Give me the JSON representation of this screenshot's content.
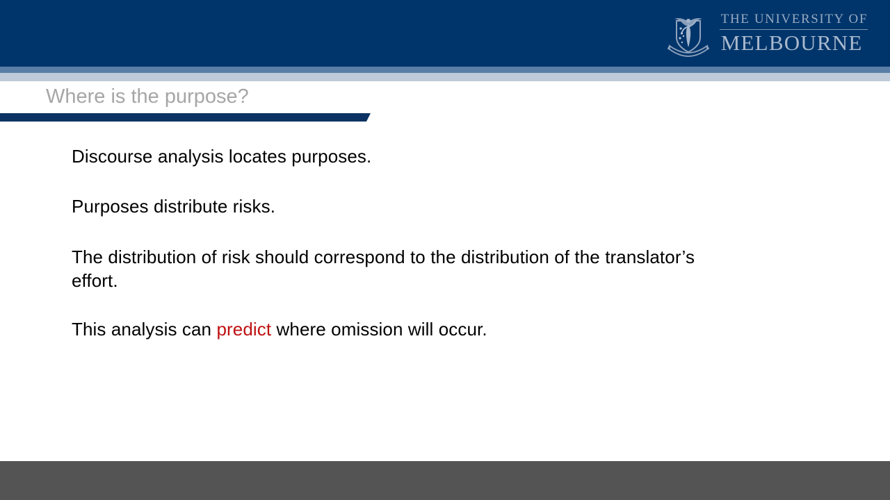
{
  "slide": {
    "title": "Where is the purpose?",
    "body_lines": [
      {
        "id": "line1",
        "text": "Discourse analysis locates purposes."
      },
      {
        "id": "line2",
        "text": "Purposes distribute risks."
      },
      {
        "id": "line3",
        "text": "The distribution of risk should correspond to the distribution of the translator’s effort."
      },
      {
        "id": "line4",
        "prefix": "This analysis can ",
        "highlight": "predict",
        "suffix": " where omission will occur."
      }
    ]
  },
  "branding": {
    "logo_line1": "THE UNIVERSITY OF",
    "logo_line2": "MELBOURNE",
    "crest_icon": "university-crest-icon"
  },
  "colors": {
    "header_navy": "#00356b",
    "stripe_slate": "#5a7fa6",
    "stripe_light": "#bfcbd8",
    "title_gray": "#a6a6a6",
    "title_underline_navy": "#0b3263",
    "highlight_red": "#bf1111",
    "footer_gray": "#545454",
    "body_text": "#000000",
    "logo_text": "#a9b9cd"
  }
}
